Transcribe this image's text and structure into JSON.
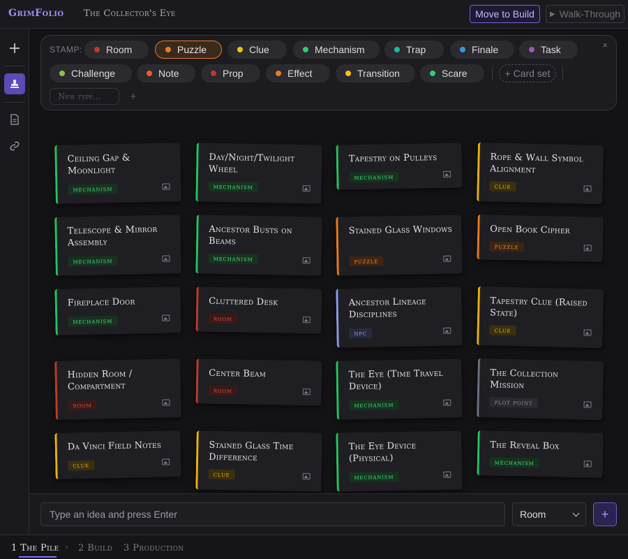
{
  "header": {
    "brand": "GrimFolio",
    "project": "The Collector's Eye",
    "move_to_build": "Move to Build",
    "walk_through": "Walk-Through"
  },
  "stamp_panel": {
    "label": "STAMP:",
    "types_row1": [
      {
        "label": "Room",
        "color": "#c0392b"
      },
      {
        "label": "Puzzle",
        "color": "#e67e22",
        "selected": true
      },
      {
        "label": "Clue",
        "color": "#f1c40f"
      },
      {
        "label": "Mechanism",
        "color": "#2ecc71"
      },
      {
        "label": "Trap",
        "color": "#1abc9c"
      },
      {
        "label": "Finale",
        "color": "#3498db"
      },
      {
        "label": "Task",
        "color": "#9b59b6"
      }
    ],
    "types_row2": [
      {
        "label": "Challenge",
        "color": "#8bc34a"
      },
      {
        "label": "Note",
        "color": "#ff5722"
      },
      {
        "label": "Prop",
        "color": "#c0392b"
      },
      {
        "label": "Effect",
        "color": "#e67e22"
      },
      {
        "label": "Transition",
        "color": "#f1c40f"
      },
      {
        "label": "Scare",
        "color": "#2ecc71"
      }
    ],
    "card_set": "+ Card set",
    "new_type_placeholder": "New type...",
    "new_type_add": "+",
    "close": "×"
  },
  "cards": [
    {
      "title": "Ceiling Gap & Moonlight",
      "tag": "mechanism",
      "kind": "mechanism"
    },
    {
      "title": "Day/Night/Twilight Wheel",
      "tag": "mechanism",
      "kind": "mechanism"
    },
    {
      "title": "Tapestry on Pulleys",
      "tag": "mechanism",
      "kind": "mechanism"
    },
    {
      "title": "Rope & Wall Symbol Alignment",
      "tag": "clue",
      "kind": "clue"
    },
    {
      "title": "Telescope & Mirror Assembly",
      "tag": "mechanism",
      "kind": "mechanism"
    },
    {
      "title": "Ancestor Busts on Beams",
      "tag": "mechanism",
      "kind": "mechanism"
    },
    {
      "title": "Stained Glass Windows",
      "tag": "puzzle",
      "kind": "puzzle"
    },
    {
      "title": "Open Book Cipher",
      "tag": "puzzle",
      "kind": "puzzle"
    },
    {
      "title": "Fireplace Door",
      "tag": "mechanism",
      "kind": "mechanism"
    },
    {
      "title": "Cluttered Desk",
      "tag": "room",
      "kind": "room"
    },
    {
      "title": "Ancestor Lineage Disciplines",
      "tag": "npc",
      "kind": "npc"
    },
    {
      "title": "Tapestry Clue (Raised State)",
      "tag": "clue",
      "kind": "clue"
    },
    {
      "title": "Hidden Room / Compartment",
      "tag": "room",
      "kind": "room"
    },
    {
      "title": "Center Beam",
      "tag": "room",
      "kind": "room"
    },
    {
      "title": "The Eye (Time Travel Device)",
      "tag": "mechanism",
      "kind": "mechanism"
    },
    {
      "title": "The Collection Mission",
      "tag": "plot point",
      "kind": "plot"
    },
    {
      "title": "Da Vinci Field Notes",
      "tag": "clue",
      "kind": "clue"
    },
    {
      "title": "Stained Glass Time Difference",
      "tag": "clue",
      "kind": "clue"
    },
    {
      "title": "The Eye Device (Physical)",
      "tag": "mechanism",
      "kind": "mechanism"
    },
    {
      "title": "The Reveal Box",
      "tag": "mechanism",
      "kind": "mechanism"
    }
  ],
  "kind_colors": {
    "mechanism": {
      "border": "#22c55e",
      "tag_bg": "#16331f",
      "tag_fg": "#4ade80"
    },
    "clue": {
      "border": "#eab308",
      "tag_bg": "#3a3010",
      "tag_fg": "#eab308"
    },
    "puzzle": {
      "border": "#ea7a1c",
      "tag_bg": "#3d2512",
      "tag_fg": "#f08a32"
    },
    "room": {
      "border": "#c0392b",
      "tag_bg": "#3a1a18",
      "tag_fg": "#d0503f"
    },
    "npc": {
      "border": "#8b9ce8",
      "tag_bg": "#272b40",
      "tag_fg": "#9aa7e0"
    },
    "plot": {
      "border": "#6b7280",
      "tag_bg": "#2a2b30",
      "tag_fg": "#8a8f99"
    }
  },
  "idea_bar": {
    "placeholder": "Type an idea and press Enter",
    "type_value": "Room",
    "add": "+"
  },
  "steps": [
    {
      "num": "1",
      "label": "The Pile",
      "active": true
    },
    {
      "num": "2",
      "label": "Build",
      "active": false
    },
    {
      "num": "3",
      "label": "Production",
      "active": false
    }
  ]
}
